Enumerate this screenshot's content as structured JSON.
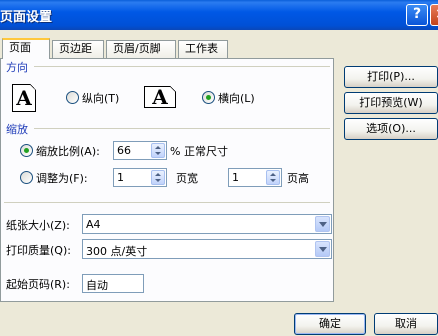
{
  "window": {
    "title": "页面设置",
    "help_label": "?",
    "close_label": "×"
  },
  "tabs": [
    {
      "label": "页面",
      "active": true
    },
    {
      "label": "页边距",
      "active": false
    },
    {
      "label": "页眉/页脚",
      "active": false
    },
    {
      "label": "工作表",
      "active": false
    }
  ],
  "orientation": {
    "section_label": "方向",
    "portrait_icon": "A",
    "portrait_label": "纵向(T)",
    "landscape_icon": "A",
    "landscape_label": "横向(L)",
    "selected": "landscape"
  },
  "scaling": {
    "section_label": "缩放",
    "adjust_to_label": "缩放比例(A):",
    "adjust_to_value": "66",
    "adjust_suffix": "% 正常尺寸",
    "fit_to_label": "调整为(F):",
    "pages_wide_value": "1",
    "pages_wide_label": "页宽",
    "pages_tall_value": "1",
    "pages_tall_label": "页高",
    "selected": "adjust"
  },
  "paper_size": {
    "label": "纸张大小(Z):",
    "value": "A4"
  },
  "print_quality": {
    "label": "打印质量(Q):",
    "value": "300 点/英寸"
  },
  "first_page_number": {
    "label": "起始页码(R):",
    "value": "自动"
  },
  "side_buttons": {
    "print": "打印(P)...",
    "print_preview": "打印预览(W)",
    "options": "选项(O)..."
  },
  "footer_buttons": {
    "ok": "确定",
    "cancel": "取消"
  }
}
